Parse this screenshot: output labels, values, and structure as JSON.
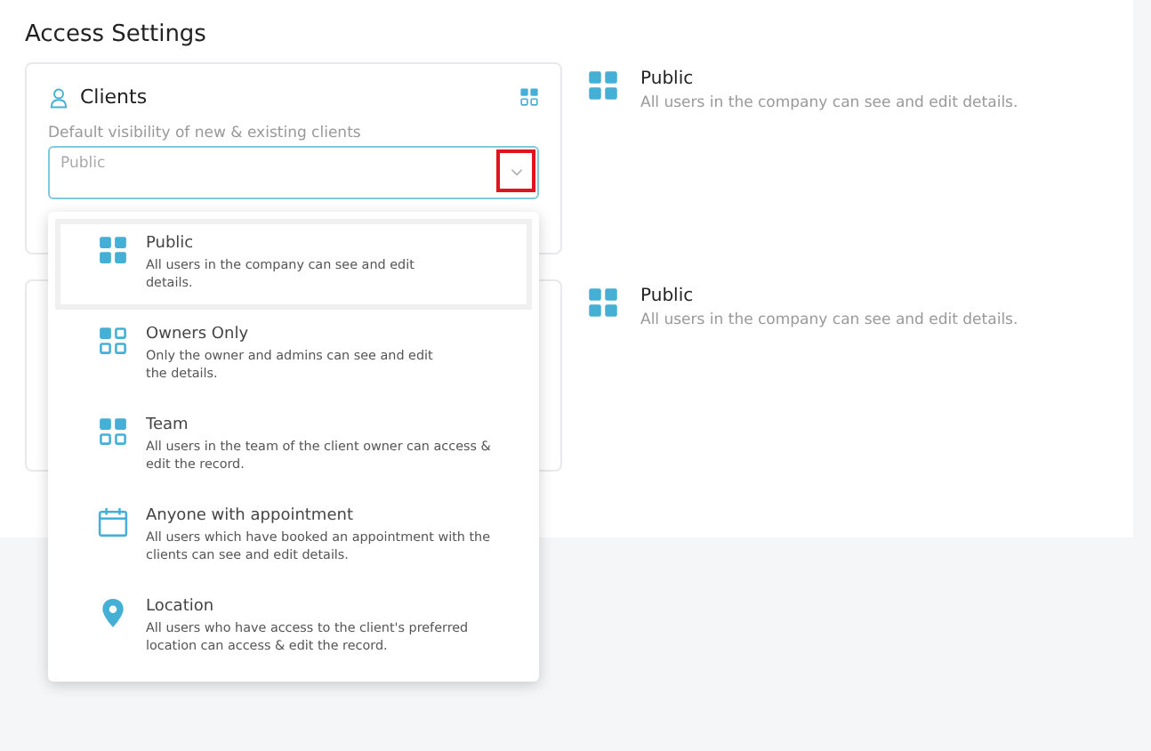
{
  "page_title": "Access Settings",
  "clients_card": {
    "title": "Clients",
    "field_label": "Default visibility of new & existing clients",
    "field_value": "Public",
    "dropdown_open": true,
    "caret_highlighted": true
  },
  "dropdown_options": [
    {
      "kind": "public",
      "title": "Public",
      "description": "All users in the company can see and edit details.",
      "selected": true
    },
    {
      "kind": "owners",
      "title": "Owners Only",
      "description": "Only the owner and admins can see and edit the details.",
      "selected": false
    },
    {
      "kind": "team",
      "title": "Team",
      "description": "All users in the team of the client owner can access & edit the record.",
      "selected": false
    },
    {
      "kind": "calendar",
      "title": "Anyone with appointment",
      "description": "All users which have booked an appointment with the clients can see and edit details.",
      "selected": false
    },
    {
      "kind": "location",
      "title": "Location",
      "description": "All users who have access to the client's preferred location can access & edit the record.",
      "selected": false
    }
  ],
  "info_rows": [
    {
      "kind": "public",
      "title": "Public",
      "description": "All users in the company can see and edit details."
    },
    {
      "kind": "public",
      "title": "Public",
      "description": "All users in the company can see and edit details."
    }
  ]
}
